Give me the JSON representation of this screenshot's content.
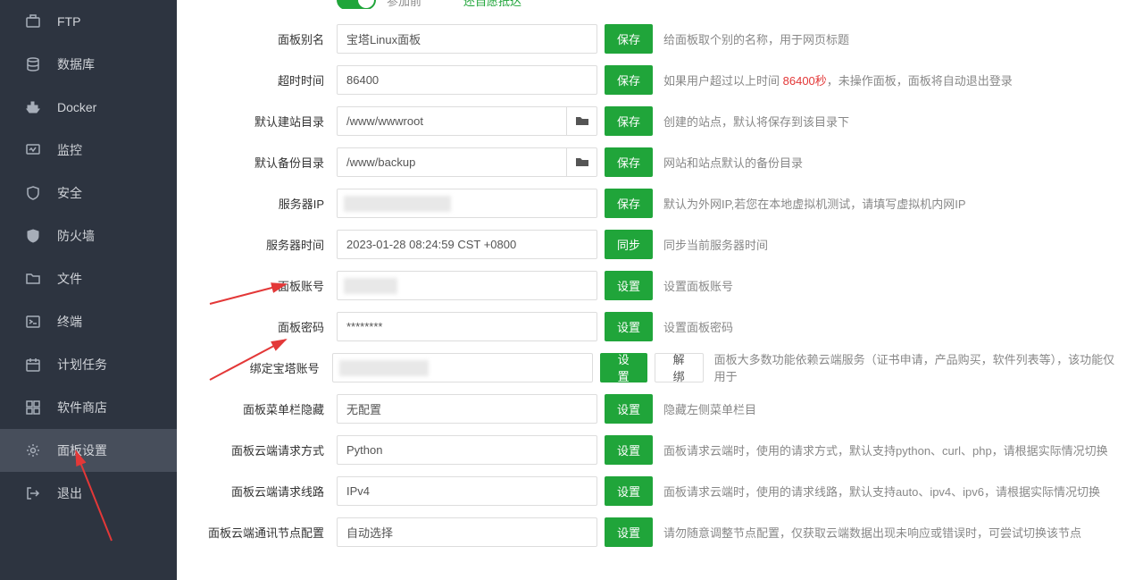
{
  "sidebar": {
    "items": [
      {
        "label": "FTP",
        "icon": "ftp"
      },
      {
        "label": "数据库",
        "icon": "database"
      },
      {
        "label": "Docker",
        "icon": "docker"
      },
      {
        "label": "监控",
        "icon": "monitor"
      },
      {
        "label": "安全",
        "icon": "shield"
      },
      {
        "label": "防火墙",
        "icon": "firewall"
      },
      {
        "label": "文件",
        "icon": "folder"
      },
      {
        "label": "终端",
        "icon": "terminal"
      },
      {
        "label": "计划任务",
        "icon": "schedule"
      },
      {
        "label": "软件商店",
        "icon": "store"
      },
      {
        "label": "面板设置",
        "icon": "gear",
        "active": true
      },
      {
        "label": "退出",
        "icon": "logout"
      }
    ]
  },
  "settings": {
    "top_help_prefix": "参加前",
    "top_help_link": "还自愿抵达",
    "panel_alias": {
      "label": "面板别名",
      "value": "宝塔Linux面板",
      "btn": "保存",
      "help": "给面板取个别的名称，用于网页标题"
    },
    "timeout": {
      "label": "超时时间",
      "value": "86400",
      "btn": "保存",
      "help_pre": "如果用户超过以上时间 ",
      "highlight": "86400秒",
      "help_post": "，未操作面板，面板将自动退出登录"
    },
    "site_path": {
      "label": "默认建站目录",
      "value": "/www/wwwroot",
      "btn": "保存",
      "help": "创建的站点，默认将保存到该目录下"
    },
    "backup_path": {
      "label": "默认备份目录",
      "value": "/www/backup",
      "btn": "保存",
      "help": "网站和站点默认的备份目录"
    },
    "server_ip": {
      "label": "服务器IP",
      "value": "",
      "btn": "保存",
      "help": "默认为外网IP,若您在本地虚拟机测试，请填写虚拟机内网IP"
    },
    "server_time": {
      "label": "服务器时间",
      "value": "2023-01-28 08:24:59 CST +0800",
      "btn": "同步",
      "help": "同步当前服务器时间"
    },
    "panel_user": {
      "label": "面板账号",
      "value": "",
      "btn": "设置",
      "help": "设置面板账号"
    },
    "panel_pwd": {
      "label": "面板密码",
      "value": "********",
      "btn": "设置",
      "help": "设置面板密码"
    },
    "bind_bt": {
      "label": "绑定宝塔账号",
      "value": "",
      "btn": "设置",
      "btn2": "解绑",
      "help": "面板大多数功能依赖云端服务（证书申请，产品购买，软件列表等），该功能仅用于"
    },
    "menu_hide": {
      "label": "面板菜单栏隐藏",
      "value": "无配置",
      "btn": "设置",
      "help": "隐藏左侧菜单栏目"
    },
    "cloud_method": {
      "label": "面板云端请求方式",
      "value": "Python",
      "btn": "设置",
      "help": "面板请求云端时，使用的请求方式，默认支持python、curl、php，请根据实际情况切换"
    },
    "cloud_route": {
      "label": "面板云端请求线路",
      "value": "IPv4",
      "btn": "设置",
      "help": "面板请求云端时，使用的请求线路，默认支持auto、ipv4、ipv6，请根据实际情况切换"
    },
    "cloud_node": {
      "label": "面板云端通讯节点配置",
      "value": "自动选择",
      "btn": "设置",
      "help": "请勿随意调整节点配置，仅获取云端数据出现未响应或错误时，可尝试切换该节点"
    }
  }
}
